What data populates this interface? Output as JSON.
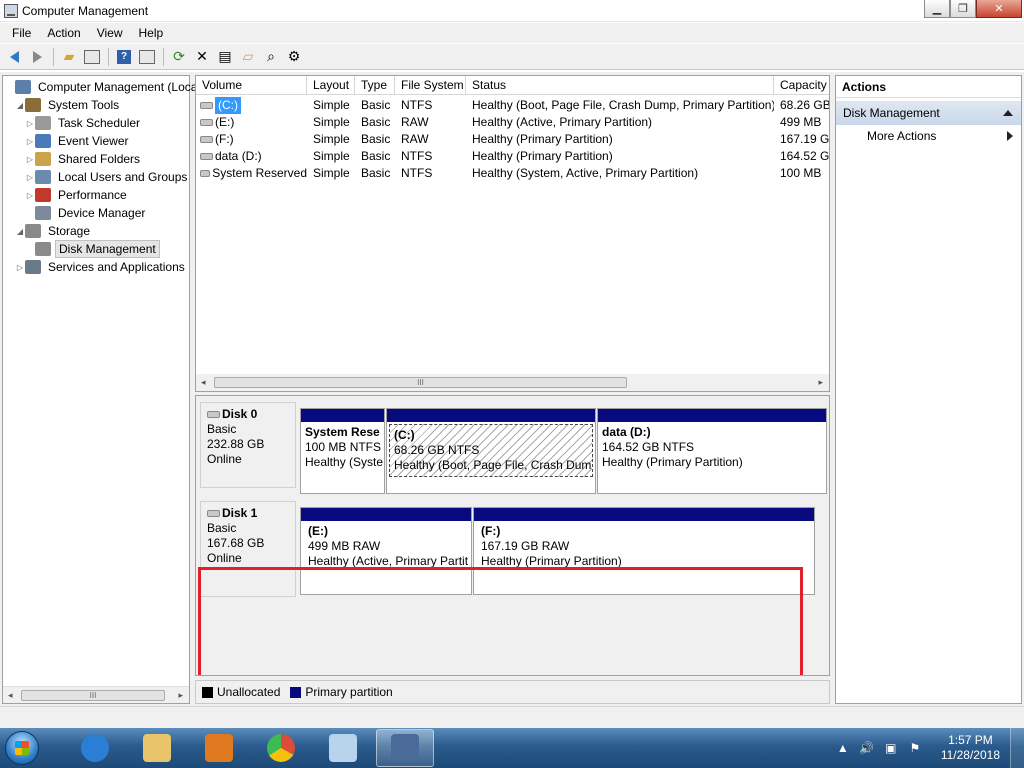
{
  "window": {
    "title": "Computer Management",
    "controls": {
      "minimize": "▁",
      "maximize": "❐",
      "close": "✕"
    }
  },
  "menu": [
    "File",
    "Action",
    "View",
    "Help"
  ],
  "toolbar": {
    "icons": [
      "back-icon",
      "forward-icon",
      "up-folder-icon",
      "show-hide-tree-icon",
      "help-icon",
      "show-hide-action-pane-icon",
      "refresh-icon",
      "delete-icon",
      "properties-icon",
      "open-icon",
      "search-icon",
      "settings-icon"
    ]
  },
  "tree": {
    "items": [
      {
        "label": "Computer Management (Local",
        "level": 0,
        "expander": "",
        "icon": "computer-management-icon",
        "color": "#5b7fa8"
      },
      {
        "label": "System Tools",
        "level": 1,
        "expander": "◢",
        "icon": "tools-icon",
        "color": "#8a6d3b"
      },
      {
        "label": "Task Scheduler",
        "level": 2,
        "expander": "▷",
        "icon": "clock-icon",
        "color": "#9a9a9a"
      },
      {
        "label": "Event Viewer",
        "level": 2,
        "expander": "▷",
        "icon": "event-viewer-icon",
        "color": "#4a7ab8"
      },
      {
        "label": "Shared Folders",
        "level": 2,
        "expander": "▷",
        "icon": "shared-folder-icon",
        "color": "#c9a44a"
      },
      {
        "label": "Local Users and Groups",
        "level": 2,
        "expander": "▷",
        "icon": "users-icon",
        "color": "#6a8ab0"
      },
      {
        "label": "Performance",
        "level": 2,
        "expander": "▷",
        "icon": "performance-icon",
        "color": "#c0392b"
      },
      {
        "label": "Device Manager",
        "level": 2,
        "expander": "",
        "icon": "device-manager-icon",
        "color": "#7a8a9a"
      },
      {
        "label": "Storage",
        "level": 1,
        "expander": "◢",
        "icon": "storage-icon",
        "color": "#8a8a8a"
      },
      {
        "label": "Disk Management",
        "level": 2,
        "expander": "",
        "icon": "disk-management-icon",
        "color": "#8a8a8a",
        "selected": true
      },
      {
        "label": "Services and Applications",
        "level": 1,
        "expander": "▷",
        "icon": "services-icon",
        "color": "#6a7a8a"
      }
    ]
  },
  "volumes": {
    "columns": [
      "Volume",
      "Layout",
      "Type",
      "File System",
      "Status",
      "Capacity"
    ],
    "rows": [
      {
        "volume": "(C:)",
        "layout": "Simple",
        "type": "Basic",
        "fs": "NTFS",
        "status": "Healthy (Boot, Page File, Crash Dump, Primary Partition)",
        "capacity": "68.26 GB",
        "selected": true
      },
      {
        "volume": "(E:)",
        "layout": "Simple",
        "type": "Basic",
        "fs": "RAW",
        "status": "Healthy (Active, Primary Partition)",
        "capacity": "499 MB"
      },
      {
        "volume": "(F:)",
        "layout": "Simple",
        "type": "Basic",
        "fs": "RAW",
        "status": "Healthy (Primary Partition)",
        "capacity": "167.19 GE"
      },
      {
        "volume": "data (D:)",
        "layout": "Simple",
        "type": "Basic",
        "fs": "NTFS",
        "status": "Healthy (Primary Partition)",
        "capacity": "164.52 GE"
      },
      {
        "volume": "System Reserved",
        "layout": "Simple",
        "type": "Basic",
        "fs": "NTFS",
        "status": "Healthy (System, Active, Primary Partition)",
        "capacity": "100 MB"
      }
    ],
    "scroll_thumb": "III"
  },
  "disks": [
    {
      "name": "Disk 0",
      "type": "Basic",
      "size": "232.88 GB",
      "state": "Online",
      "partitions": [
        {
          "name": "System Rese",
          "size": "100 MB NTFS",
          "status": "Healthy (Syste"
        },
        {
          "name": "(C:)",
          "size": "68.26 GB NTFS",
          "status": "Healthy (Boot, Page File, Crash Dump"
        },
        {
          "name": "data  (D:)",
          "size": "164.52 GB NTFS",
          "status": "Healthy (Primary Partition)"
        }
      ]
    },
    {
      "name": "Disk 1",
      "type": "Basic",
      "size": "167.68 GB",
      "state": "Online",
      "partitions": [
        {
          "name": "(E:)",
          "size": "499 MB RAW",
          "status": "Healthy (Active, Primary Partit"
        },
        {
          "name": "(F:)",
          "size": "167.19 GB RAW",
          "status": "Healthy (Primary Partition)"
        }
      ]
    }
  ],
  "legend": [
    {
      "label": "Unallocated",
      "color": "#000000"
    },
    {
      "label": "Primary partition",
      "color": "#0a0a80"
    }
  ],
  "actions": {
    "title": "Actions",
    "section": "Disk Management",
    "items": [
      "More Actions"
    ]
  },
  "colors": {
    "highlight": "#e0202a",
    "partition_bar": "#0a0a80",
    "selection": "#3399ff"
  },
  "taskbar": {
    "apps": [
      {
        "name": "internet-explorer-icon",
        "color": "#2a7fd4"
      },
      {
        "name": "file-explorer-icon",
        "color": "#e8c46a"
      },
      {
        "name": "media-player-icon",
        "color": "#e07a20"
      },
      {
        "name": "chrome-icon",
        "color": "#dd4b39"
      },
      {
        "name": "notepad-icon",
        "color": "#b8d4ec"
      },
      {
        "name": "computer-management-taskbar-icon",
        "color": "#4a6a9a",
        "active": true
      }
    ],
    "tray_icons": [
      "▲",
      "🔊",
      "▣",
      "⚑"
    ],
    "time": "1:57 PM",
    "date": "11/28/2018"
  }
}
